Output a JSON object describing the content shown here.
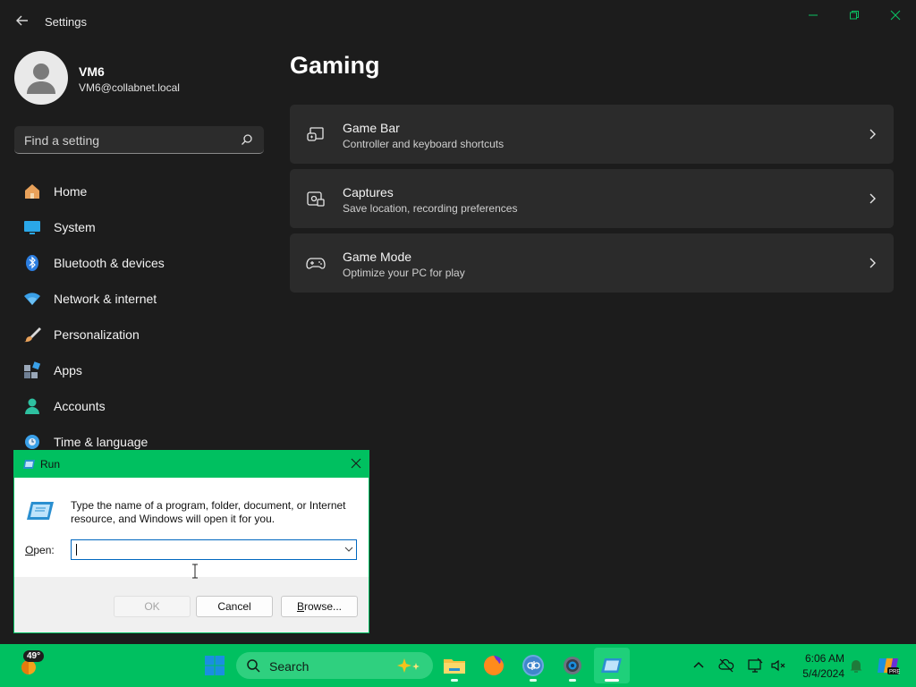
{
  "window": {
    "title": "Settings"
  },
  "profile": {
    "name": "VM6",
    "email": "VM6@collabnet.local"
  },
  "search": {
    "placeholder": "Find a setting"
  },
  "nav": {
    "items": [
      {
        "label": "Home",
        "icon": "home-icon"
      },
      {
        "label": "System",
        "icon": "monitor-icon"
      },
      {
        "label": "Bluetooth & devices",
        "icon": "bluetooth-icon"
      },
      {
        "label": "Network & internet",
        "icon": "wifi-icon"
      },
      {
        "label": "Personalization",
        "icon": "brush-icon"
      },
      {
        "label": "Apps",
        "icon": "apps-icon"
      },
      {
        "label": "Accounts",
        "icon": "person-icon"
      },
      {
        "label": "Time & language",
        "icon": "globe-clock-icon"
      }
    ]
  },
  "page": {
    "title": "Gaming",
    "cards": [
      {
        "title": "Game Bar",
        "subtitle": "Controller and keyboard shortcuts",
        "icon": "game-bar-icon"
      },
      {
        "title": "Captures",
        "subtitle": "Save location, recording preferences",
        "icon": "capture-icon"
      },
      {
        "title": "Game Mode",
        "subtitle": "Optimize your PC for play",
        "icon": "gamepad-icon"
      }
    ]
  },
  "run_dialog": {
    "title": "Run",
    "description": "Type the name of a program, folder, document, or Internet resource, and Windows will open it for you.",
    "open_label_prefix": "",
    "open_label_accel": "O",
    "open_label_rest": "pen:",
    "open_value": "",
    "ok_label": "OK",
    "cancel_label": "Cancel",
    "browse_label_accel": "B",
    "browse_label_rest": "rowse..."
  },
  "taskbar": {
    "weather_temp": "49°",
    "search_label": "Search",
    "time": "6:06 AM",
    "date": "5/4/2024"
  },
  "colors": {
    "accent": "#00c060",
    "settings_bg": "#1c1c1c",
    "card_bg": "#2b2b2b"
  }
}
